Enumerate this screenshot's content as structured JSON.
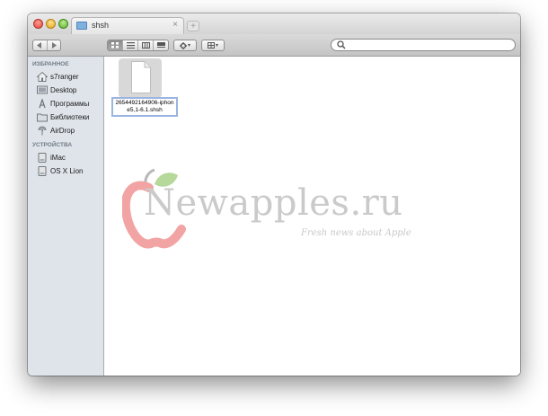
{
  "window": {
    "tab_title": "shsh",
    "tab_close": "×",
    "new_tab": "+"
  },
  "toolbar": {
    "view_modes": [
      "icon",
      "list",
      "columns",
      "cover-flow"
    ],
    "active_view": "icon",
    "action_menu": "▾",
    "arrange_menu": "▾",
    "search": {
      "value": "",
      "placeholder": ""
    }
  },
  "sidebar": {
    "sections": [
      {
        "header": "ИЗБРАННОЕ",
        "items": [
          {
            "label": "s7ranger",
            "icon": "home-icon"
          },
          {
            "label": "Desktop",
            "icon": "desktop-icon"
          },
          {
            "label": "Программы",
            "icon": "applications-icon"
          },
          {
            "label": "Библиотеки",
            "icon": "folder-icon"
          },
          {
            "label": "AirDrop",
            "icon": "airdrop-icon"
          }
        ]
      },
      {
        "header": "УСТРОЙСТВА",
        "items": [
          {
            "label": "iMac",
            "icon": "drive-icon"
          },
          {
            "label": "OS X Lion",
            "icon": "drive-icon"
          }
        ]
      }
    ]
  },
  "files": [
    {
      "name": "2654492164906-iphone5,1-6.1.shsh",
      "selected": true,
      "icon": "document-icon"
    }
  ],
  "watermark": {
    "text": "Newapples.ru",
    "tagline": "Fresh news about Apple"
  },
  "colors": {
    "sidebar_bg": "#dfe4ea",
    "selection": "#9bb5e0",
    "accent_red": "#e85050",
    "accent_green": "#8cc063"
  }
}
